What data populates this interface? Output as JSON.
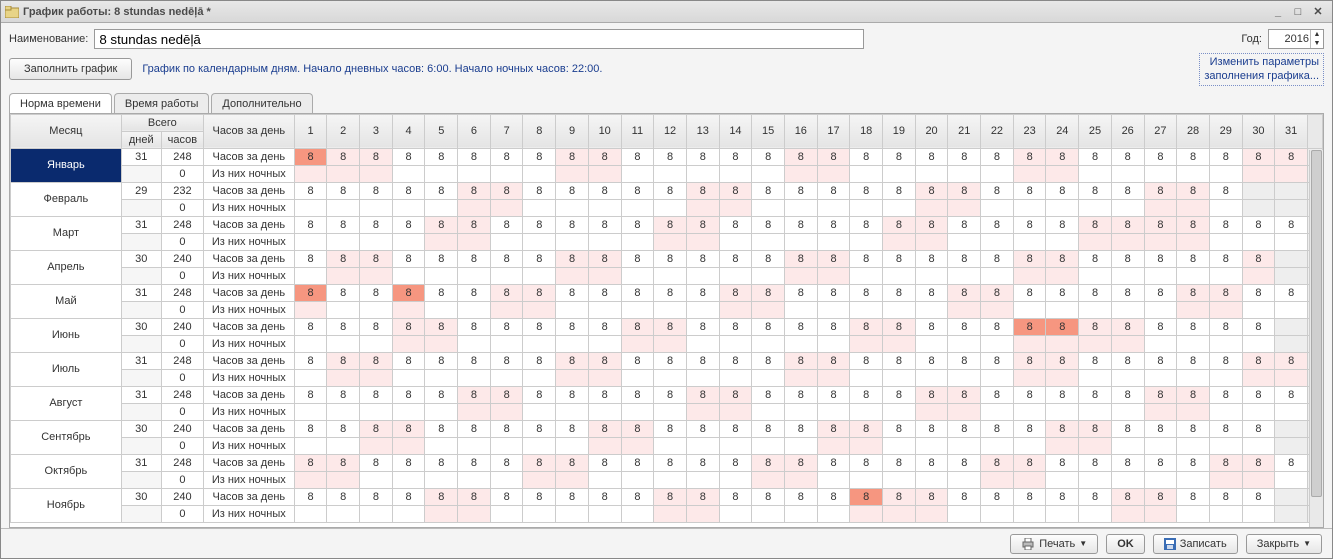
{
  "window_title": "График работы: 8 stundas nedēļā *",
  "labels": {
    "name": "Наименование:",
    "year": "Год:",
    "fill_btn": "Заполнить график",
    "info": "График по календарным дням. Начало дневных часов: 6:00. Начало ночных часов: 22:00.",
    "param_link1": "Изменить параметры",
    "param_link2": "заполнения графика..."
  },
  "name_value": "8 stundas nedēļā",
  "year_value": "2016",
  "tabs": [
    "Норма времени",
    "Время работы",
    "Дополнительно"
  ],
  "headers": {
    "month": "Месяц",
    "total": "Всего",
    "days": "дней",
    "hours": "часов",
    "per_day": "Часов за день"
  },
  "metric_rows": [
    "Часов за день",
    "Из них ночных"
  ],
  "day_numbers": [
    "1",
    "2",
    "3",
    "4",
    "5",
    "6",
    "7",
    "8",
    "9",
    "10",
    "11",
    "12",
    "13",
    "14",
    "15",
    "16",
    "17",
    "18",
    "19",
    "20",
    "21",
    "22",
    "23",
    "24",
    "25",
    "26",
    "27",
    "28",
    "29",
    "30",
    "31"
  ],
  "months": [
    {
      "name": "Январь",
      "selected": true,
      "days": 31,
      "hours": 248,
      "night": 0,
      "cells": [
        {
          "v": "8",
          "c": "red"
        },
        {
          "v": "8",
          "c": "pink"
        },
        {
          "v": "8",
          "c": "pink"
        },
        {
          "v": "8"
        },
        {
          "v": "8"
        },
        {
          "v": "8"
        },
        {
          "v": "8"
        },
        {
          "v": "8"
        },
        {
          "v": "8",
          "c": "pink"
        },
        {
          "v": "8",
          "c": "pink"
        },
        {
          "v": "8"
        },
        {
          "v": "8"
        },
        {
          "v": "8"
        },
        {
          "v": "8"
        },
        {
          "v": "8"
        },
        {
          "v": "8",
          "c": "pink"
        },
        {
          "v": "8",
          "c": "pink"
        },
        {
          "v": "8"
        },
        {
          "v": "8"
        },
        {
          "v": "8"
        },
        {
          "v": "8"
        },
        {
          "v": "8"
        },
        {
          "v": "8",
          "c": "pink"
        },
        {
          "v": "8",
          "c": "pink"
        },
        {
          "v": "8"
        },
        {
          "v": "8"
        },
        {
          "v": "8"
        },
        {
          "v": "8"
        },
        {
          "v": "8"
        },
        {
          "v": "8",
          "c": "pink"
        },
        {
          "v": "8",
          "c": "pink"
        }
      ]
    },
    {
      "name": "Февраль",
      "days": 29,
      "hours": 232,
      "night": 0,
      "cells": [
        {
          "v": "8"
        },
        {
          "v": "8"
        },
        {
          "v": "8"
        },
        {
          "v": "8"
        },
        {
          "v": "8"
        },
        {
          "v": "8",
          "c": "pink"
        },
        {
          "v": "8",
          "c": "pink"
        },
        {
          "v": "8"
        },
        {
          "v": "8"
        },
        {
          "v": "8"
        },
        {
          "v": "8"
        },
        {
          "v": "8"
        },
        {
          "v": "8",
          "c": "pink"
        },
        {
          "v": "8",
          "c": "pink"
        },
        {
          "v": "8"
        },
        {
          "v": "8"
        },
        {
          "v": "8"
        },
        {
          "v": "8"
        },
        {
          "v": "8"
        },
        {
          "v": "8",
          "c": "pink"
        },
        {
          "v": "8",
          "c": "pink"
        },
        {
          "v": "8"
        },
        {
          "v": "8"
        },
        {
          "v": "8"
        },
        {
          "v": "8"
        },
        {
          "v": "8"
        },
        {
          "v": "8",
          "c": "pink"
        },
        {
          "v": "8",
          "c": "pink"
        },
        {
          "v": "8"
        },
        {
          "v": "",
          "c": "colgrey"
        },
        {
          "v": "",
          "c": "colgrey"
        }
      ]
    },
    {
      "name": "Март",
      "days": 31,
      "hours": 248,
      "night": 0,
      "cells": [
        {
          "v": "8"
        },
        {
          "v": "8"
        },
        {
          "v": "8"
        },
        {
          "v": "8"
        },
        {
          "v": "8",
          "c": "pink"
        },
        {
          "v": "8",
          "c": "pink"
        },
        {
          "v": "8"
        },
        {
          "v": "8"
        },
        {
          "v": "8"
        },
        {
          "v": "8"
        },
        {
          "v": "8"
        },
        {
          "v": "8",
          "c": "pink"
        },
        {
          "v": "8",
          "c": "pink"
        },
        {
          "v": "8"
        },
        {
          "v": "8"
        },
        {
          "v": "8"
        },
        {
          "v": "8"
        },
        {
          "v": "8"
        },
        {
          "v": "8",
          "c": "pink"
        },
        {
          "v": "8",
          "c": "pink"
        },
        {
          "v": "8"
        },
        {
          "v": "8"
        },
        {
          "v": "8"
        },
        {
          "v": "8"
        },
        {
          "v": "8",
          "c": "pink"
        },
        {
          "v": "8",
          "c": "pink"
        },
        {
          "v": "8",
          "c": "pink"
        },
        {
          "v": "8",
          "c": "pink"
        },
        {
          "v": "8"
        },
        {
          "v": "8"
        },
        {
          "v": "8"
        }
      ]
    },
    {
      "name": "Апрель",
      "days": 30,
      "hours": 240,
      "night": 0,
      "cells": [
        {
          "v": "8"
        },
        {
          "v": "8",
          "c": "pink"
        },
        {
          "v": "8",
          "c": "pink"
        },
        {
          "v": "8"
        },
        {
          "v": "8"
        },
        {
          "v": "8"
        },
        {
          "v": "8"
        },
        {
          "v": "8"
        },
        {
          "v": "8",
          "c": "pink"
        },
        {
          "v": "8",
          "c": "pink"
        },
        {
          "v": "8"
        },
        {
          "v": "8"
        },
        {
          "v": "8"
        },
        {
          "v": "8"
        },
        {
          "v": "8"
        },
        {
          "v": "8",
          "c": "pink"
        },
        {
          "v": "8",
          "c": "pink"
        },
        {
          "v": "8"
        },
        {
          "v": "8"
        },
        {
          "v": "8"
        },
        {
          "v": "8"
        },
        {
          "v": "8"
        },
        {
          "v": "8",
          "c": "pink"
        },
        {
          "v": "8",
          "c": "pink"
        },
        {
          "v": "8"
        },
        {
          "v": "8"
        },
        {
          "v": "8"
        },
        {
          "v": "8"
        },
        {
          "v": "8"
        },
        {
          "v": "8",
          "c": "pink"
        },
        {
          "v": "",
          "c": "colgrey"
        }
      ]
    },
    {
      "name": "Май",
      "days": 31,
      "hours": 248,
      "night": 0,
      "cells": [
        {
          "v": "8",
          "c": "red"
        },
        {
          "v": "8"
        },
        {
          "v": "8"
        },
        {
          "v": "8",
          "c": "red"
        },
        {
          "v": "8"
        },
        {
          "v": "8"
        },
        {
          "v": "8",
          "c": "pink"
        },
        {
          "v": "8",
          "c": "pink"
        },
        {
          "v": "8"
        },
        {
          "v": "8"
        },
        {
          "v": "8"
        },
        {
          "v": "8"
        },
        {
          "v": "8"
        },
        {
          "v": "8",
          "c": "pink"
        },
        {
          "v": "8",
          "c": "pink"
        },
        {
          "v": "8"
        },
        {
          "v": "8"
        },
        {
          "v": "8"
        },
        {
          "v": "8"
        },
        {
          "v": "8"
        },
        {
          "v": "8",
          "c": "pink"
        },
        {
          "v": "8",
          "c": "pink"
        },
        {
          "v": "8"
        },
        {
          "v": "8"
        },
        {
          "v": "8"
        },
        {
          "v": "8"
        },
        {
          "v": "8"
        },
        {
          "v": "8",
          "c": "pink"
        },
        {
          "v": "8",
          "c": "pink"
        },
        {
          "v": "8"
        },
        {
          "v": "8"
        }
      ]
    },
    {
      "name": "Июнь",
      "days": 30,
      "hours": 240,
      "night": 0,
      "cells": [
        {
          "v": "8"
        },
        {
          "v": "8"
        },
        {
          "v": "8"
        },
        {
          "v": "8",
          "c": "pink"
        },
        {
          "v": "8",
          "c": "pink"
        },
        {
          "v": "8"
        },
        {
          "v": "8"
        },
        {
          "v": "8"
        },
        {
          "v": "8"
        },
        {
          "v": "8"
        },
        {
          "v": "8",
          "c": "pink"
        },
        {
          "v": "8",
          "c": "pink"
        },
        {
          "v": "8"
        },
        {
          "v": "8"
        },
        {
          "v": "8"
        },
        {
          "v": "8"
        },
        {
          "v": "8"
        },
        {
          "v": "8",
          "c": "pink"
        },
        {
          "v": "8",
          "c": "pink"
        },
        {
          "v": "8"
        },
        {
          "v": "8"
        },
        {
          "v": "8"
        },
        {
          "v": "8",
          "c": "red"
        },
        {
          "v": "8",
          "c": "red"
        },
        {
          "v": "8",
          "c": "pink"
        },
        {
          "v": "8",
          "c": "pink"
        },
        {
          "v": "8"
        },
        {
          "v": "8"
        },
        {
          "v": "8"
        },
        {
          "v": "8"
        },
        {
          "v": "",
          "c": "colgrey"
        }
      ]
    },
    {
      "name": "Июль",
      "days": 31,
      "hours": 248,
      "night": 0,
      "cells": [
        {
          "v": "8"
        },
        {
          "v": "8",
          "c": "pink"
        },
        {
          "v": "8",
          "c": "pink"
        },
        {
          "v": "8"
        },
        {
          "v": "8"
        },
        {
          "v": "8"
        },
        {
          "v": "8"
        },
        {
          "v": "8"
        },
        {
          "v": "8",
          "c": "pink"
        },
        {
          "v": "8",
          "c": "pink"
        },
        {
          "v": "8"
        },
        {
          "v": "8"
        },
        {
          "v": "8"
        },
        {
          "v": "8"
        },
        {
          "v": "8"
        },
        {
          "v": "8",
          "c": "pink"
        },
        {
          "v": "8",
          "c": "pink"
        },
        {
          "v": "8"
        },
        {
          "v": "8"
        },
        {
          "v": "8"
        },
        {
          "v": "8"
        },
        {
          "v": "8"
        },
        {
          "v": "8",
          "c": "pink"
        },
        {
          "v": "8",
          "c": "pink"
        },
        {
          "v": "8"
        },
        {
          "v": "8"
        },
        {
          "v": "8"
        },
        {
          "v": "8"
        },
        {
          "v": "8"
        },
        {
          "v": "8",
          "c": "pink"
        },
        {
          "v": "8",
          "c": "pink"
        }
      ]
    },
    {
      "name": "Август",
      "days": 31,
      "hours": 248,
      "night": 0,
      "cells": [
        {
          "v": "8"
        },
        {
          "v": "8"
        },
        {
          "v": "8"
        },
        {
          "v": "8"
        },
        {
          "v": "8"
        },
        {
          "v": "8",
          "c": "pink"
        },
        {
          "v": "8",
          "c": "pink"
        },
        {
          "v": "8"
        },
        {
          "v": "8"
        },
        {
          "v": "8"
        },
        {
          "v": "8"
        },
        {
          "v": "8"
        },
        {
          "v": "8",
          "c": "pink"
        },
        {
          "v": "8",
          "c": "pink"
        },
        {
          "v": "8"
        },
        {
          "v": "8"
        },
        {
          "v": "8"
        },
        {
          "v": "8"
        },
        {
          "v": "8"
        },
        {
          "v": "8",
          "c": "pink"
        },
        {
          "v": "8",
          "c": "pink"
        },
        {
          "v": "8"
        },
        {
          "v": "8"
        },
        {
          "v": "8"
        },
        {
          "v": "8"
        },
        {
          "v": "8"
        },
        {
          "v": "8",
          "c": "pink"
        },
        {
          "v": "8",
          "c": "pink"
        },
        {
          "v": "8"
        },
        {
          "v": "8"
        },
        {
          "v": "8"
        }
      ]
    },
    {
      "name": "Сентябрь",
      "days": 30,
      "hours": 240,
      "night": 0,
      "cells": [
        {
          "v": "8"
        },
        {
          "v": "8"
        },
        {
          "v": "8",
          "c": "pink"
        },
        {
          "v": "8",
          "c": "pink"
        },
        {
          "v": "8"
        },
        {
          "v": "8"
        },
        {
          "v": "8"
        },
        {
          "v": "8"
        },
        {
          "v": "8"
        },
        {
          "v": "8",
          "c": "pink"
        },
        {
          "v": "8",
          "c": "pink"
        },
        {
          "v": "8"
        },
        {
          "v": "8"
        },
        {
          "v": "8"
        },
        {
          "v": "8"
        },
        {
          "v": "8"
        },
        {
          "v": "8",
          "c": "pink"
        },
        {
          "v": "8",
          "c": "pink"
        },
        {
          "v": "8"
        },
        {
          "v": "8"
        },
        {
          "v": "8"
        },
        {
          "v": "8"
        },
        {
          "v": "8"
        },
        {
          "v": "8",
          "c": "pink"
        },
        {
          "v": "8",
          "c": "pink"
        },
        {
          "v": "8"
        },
        {
          "v": "8"
        },
        {
          "v": "8"
        },
        {
          "v": "8"
        },
        {
          "v": "8"
        },
        {
          "v": "",
          "c": "colgrey"
        }
      ]
    },
    {
      "name": "Октябрь",
      "days": 31,
      "hours": 248,
      "night": 0,
      "cells": [
        {
          "v": "8",
          "c": "pink"
        },
        {
          "v": "8",
          "c": "pink"
        },
        {
          "v": "8"
        },
        {
          "v": "8"
        },
        {
          "v": "8"
        },
        {
          "v": "8"
        },
        {
          "v": "8"
        },
        {
          "v": "8",
          "c": "pink"
        },
        {
          "v": "8",
          "c": "pink"
        },
        {
          "v": "8"
        },
        {
          "v": "8"
        },
        {
          "v": "8"
        },
        {
          "v": "8"
        },
        {
          "v": "8"
        },
        {
          "v": "8",
          "c": "pink"
        },
        {
          "v": "8",
          "c": "pink"
        },
        {
          "v": "8"
        },
        {
          "v": "8"
        },
        {
          "v": "8"
        },
        {
          "v": "8"
        },
        {
          "v": "8"
        },
        {
          "v": "8",
          "c": "pink"
        },
        {
          "v": "8",
          "c": "pink"
        },
        {
          "v": "8"
        },
        {
          "v": "8"
        },
        {
          "v": "8"
        },
        {
          "v": "8"
        },
        {
          "v": "8"
        },
        {
          "v": "8",
          "c": "pink"
        },
        {
          "v": "8",
          "c": "pink"
        },
        {
          "v": "8"
        }
      ]
    },
    {
      "name": "Ноябрь",
      "days": 30,
      "hours": 240,
      "night": 0,
      "cells": [
        {
          "v": "8"
        },
        {
          "v": "8"
        },
        {
          "v": "8"
        },
        {
          "v": "8"
        },
        {
          "v": "8",
          "c": "pink"
        },
        {
          "v": "8",
          "c": "pink"
        },
        {
          "v": "8"
        },
        {
          "v": "8"
        },
        {
          "v": "8"
        },
        {
          "v": "8"
        },
        {
          "v": "8"
        },
        {
          "v": "8",
          "c": "pink"
        },
        {
          "v": "8",
          "c": "pink"
        },
        {
          "v": "8"
        },
        {
          "v": "8"
        },
        {
          "v": "8"
        },
        {
          "v": "8"
        },
        {
          "v": "8",
          "c": "red"
        },
        {
          "v": "8",
          "c": "pink"
        },
        {
          "v": "8",
          "c": "pink"
        },
        {
          "v": "8"
        },
        {
          "v": "8"
        },
        {
          "v": "8"
        },
        {
          "v": "8"
        },
        {
          "v": "8"
        },
        {
          "v": "8",
          "c": "pink"
        },
        {
          "v": "8",
          "c": "pink"
        },
        {
          "v": "8"
        },
        {
          "v": "8"
        },
        {
          "v": "8"
        },
        {
          "v": "",
          "c": "colgrey"
        }
      ]
    }
  ],
  "footer": {
    "print": "Печать",
    "ok": "OK",
    "save": "Записать",
    "close": "Закрыть"
  }
}
